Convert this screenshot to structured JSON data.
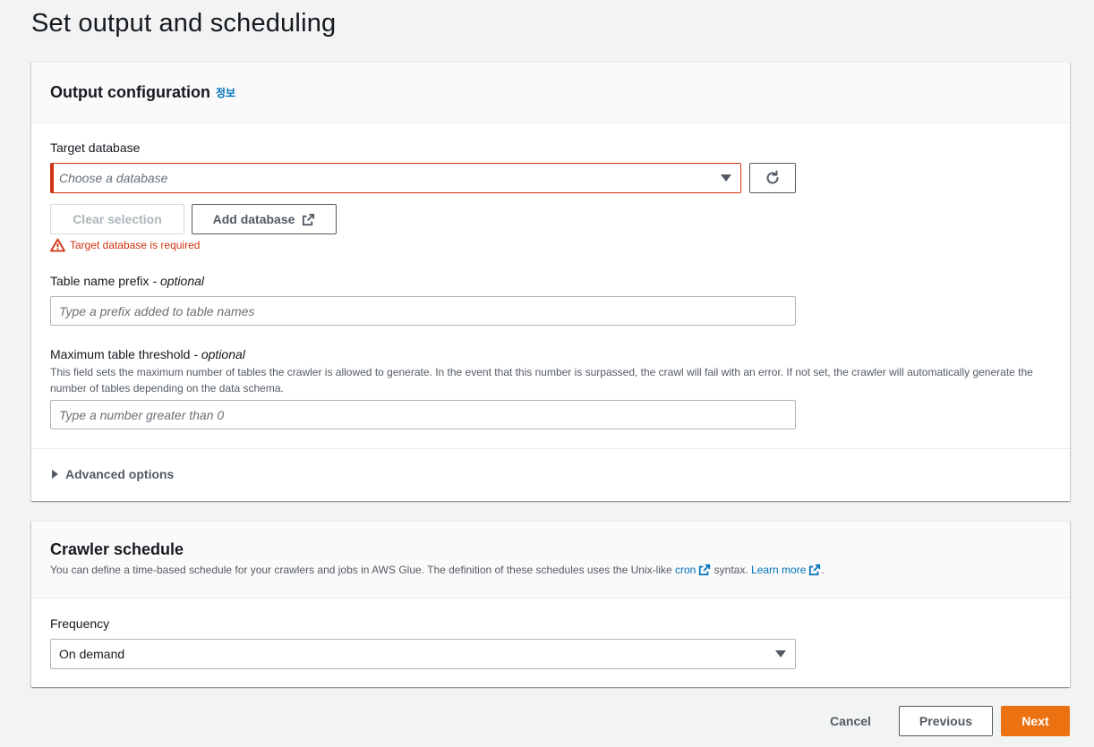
{
  "page": {
    "title": "Set output and scheduling"
  },
  "output_config": {
    "title": "Output configuration",
    "info": "정보",
    "target_db": {
      "label": "Target database",
      "placeholder": "Choose a database",
      "clear_label": "Clear selection",
      "add_label": "Add database",
      "error": "Target database is required"
    },
    "prefix": {
      "label": "Table name prefix",
      "optional": "- optional",
      "placeholder": "Type a prefix added to table names"
    },
    "threshold": {
      "label": "Maximum table threshold",
      "optional": "- optional",
      "description": "This field sets the maximum number of tables the crawler is allowed to generate. In the event that this number is surpassed, the crawl will fail with an error. If not set, the crawler will automatically generate the number of tables depending on the data schema.",
      "placeholder": "Type a number greater than 0"
    },
    "advanced": "Advanced options"
  },
  "schedule": {
    "title": "Crawler schedule",
    "desc_prefix": "You can define a time-based schedule for your crawlers and jobs in AWS Glue. The definition of these schedules uses the Unix-like",
    "cron_link": "cron",
    "desc_mid": "syntax.",
    "learn_more": "Learn more",
    "desc_end": ".",
    "frequency_label": "Frequency",
    "frequency_value": "On demand"
  },
  "footer": {
    "cancel": "Cancel",
    "previous": "Previous",
    "next": "Next"
  },
  "colors": {
    "accent": "#ec7211",
    "error": "#d13212",
    "link": "#0073bb"
  }
}
